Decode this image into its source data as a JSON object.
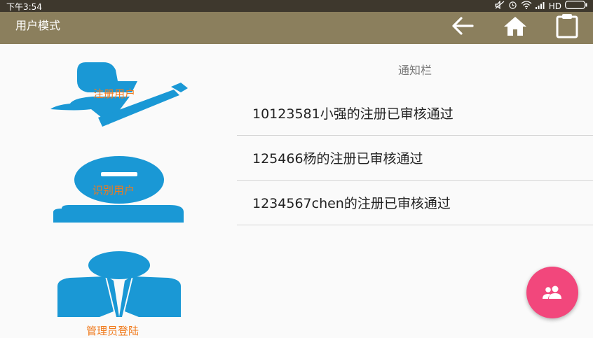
{
  "status_bar": {
    "time": "下午3:54",
    "network_label": "HD",
    "icons": [
      "mute-icon",
      "alarm-icon",
      "wifi-icon",
      "signal-icon",
      "battery-icon"
    ]
  },
  "toolbar": {
    "title": "用户模式",
    "background_color": "#8b7f5d",
    "buttons": [
      "back-arrow-icon",
      "home-icon",
      "clipboard-icon"
    ]
  },
  "menu": {
    "register_label": "注册用户",
    "identify_label": "识别用户",
    "admin_label": "管理员登陆",
    "icon_color": "#1a98d5",
    "label_color": "#f07a1c"
  },
  "notice": {
    "title": "通知栏",
    "items": [
      "10123581小强的注册已审核通过",
      "125466杨的注册已审核通过",
      "1234567chen的注册已审核通过"
    ]
  },
  "fab": {
    "icon": "group-icon",
    "color": "#f2477c"
  }
}
